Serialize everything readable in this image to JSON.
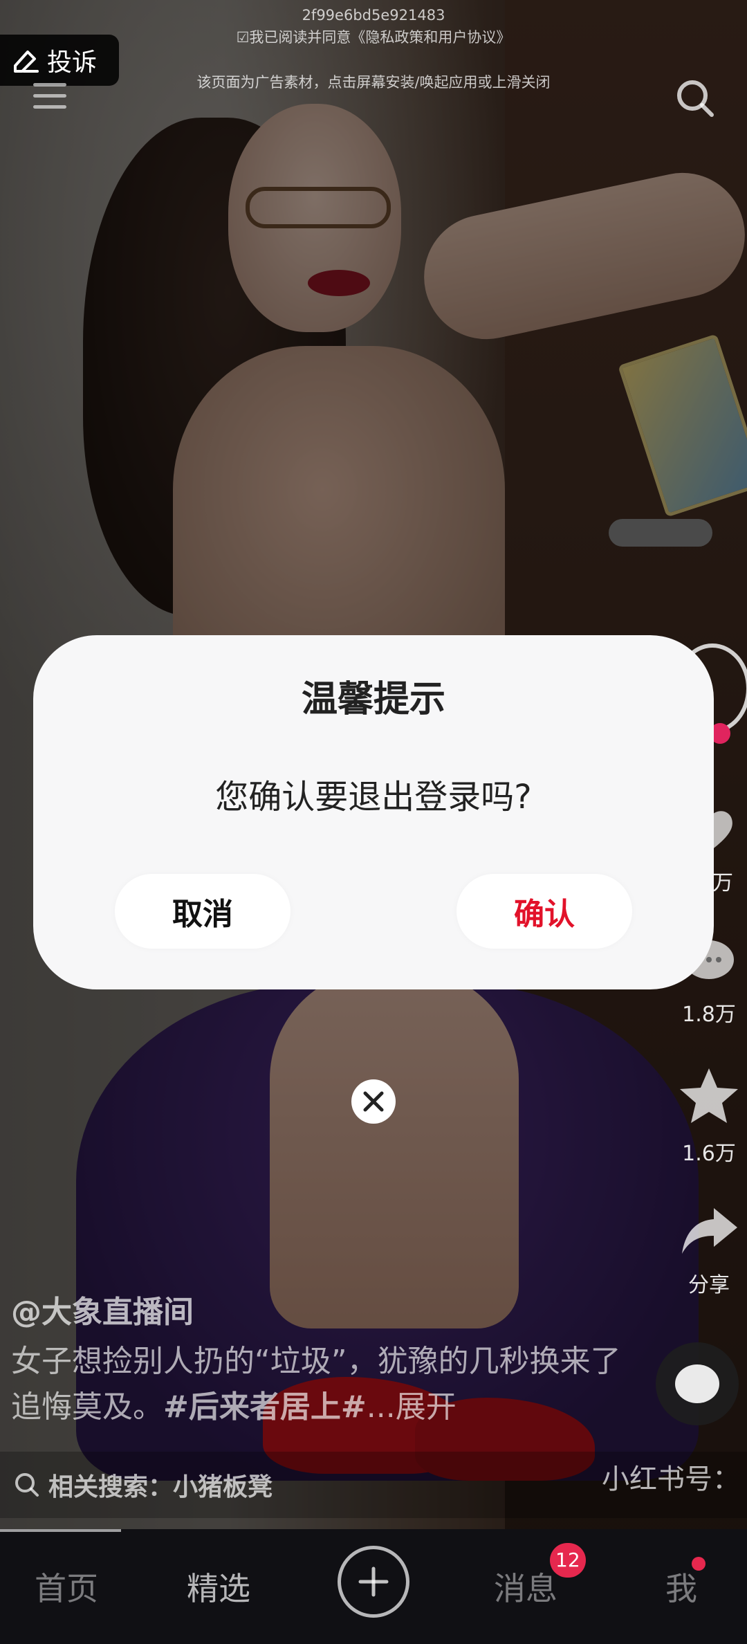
{
  "ad_header": {
    "id_text": "2f99e6bd5e921483",
    "agree_text": "☑我已阅读并同意《隐私政策和用户协议》",
    "ad_notice": "该页面为广告素材，点击屏幕安装/唤起应用或上滑关闭"
  },
  "complain": {
    "label": "投诉",
    "icon": "edit-icon"
  },
  "side_actions": {
    "like_count": "万",
    "comment_count": "1.8万",
    "favorite_count": "1.6万",
    "share_label": "分享"
  },
  "post": {
    "author": "@大象直播间",
    "caption_text": "女子想捡别人扔的“垃圾”，犹豫的几秒换来了追悔莫及。",
    "caption_tag": "#后来者居上#",
    "caption_more": "...展开"
  },
  "related_search": {
    "label": "相关搜索：小猪板凳",
    "right_text": "小红书号："
  },
  "dialog": {
    "title": "温馨提示",
    "message": "您确认要退出登录吗?",
    "cancel_label": "取消",
    "confirm_label": "确认",
    "confirm_color": "#e2122a"
  },
  "bottom_nav": {
    "items": [
      "首页",
      "精选",
      "消息",
      "我"
    ],
    "message_badge": "12"
  }
}
